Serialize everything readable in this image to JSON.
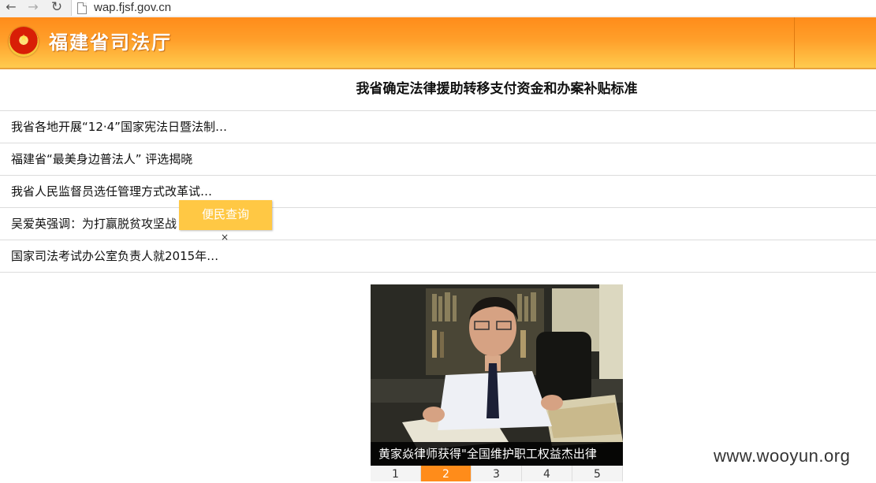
{
  "browser": {
    "back_icon": "arrow-left-icon",
    "forward_icon": "arrow-right-icon",
    "reload_icon": "reload-icon",
    "url": "wap.fjsf.gov.cn"
  },
  "header": {
    "title": "福建省司法厅",
    "emblem_icon": "national-emblem-icon",
    "colors": {
      "top": "#ff8c1a",
      "bottom": "#ffcb4e"
    }
  },
  "headline": "我省确定法律援助转移支付资金和办案补贴标准",
  "news": [
    "我省各地开展“12·4”国家宪法日暨法制…",
    "福建省“最美身边普法人” 评选揭晓",
    "我省人民监督员选任管理方式改革试…",
    "吴爱英强调：为打赢脱贫攻坚战",
    "国家司法考试办公室负责人就2015年…"
  ],
  "float_button": {
    "label": "便民查询",
    "close": "×"
  },
  "carousel": {
    "caption": "黄家焱律师获得\"全国维护职工权益杰出律",
    "pages": [
      "1",
      "2",
      "3",
      "4",
      "5"
    ],
    "active_page": "2"
  },
  "watermark": "www.wooyun.org"
}
